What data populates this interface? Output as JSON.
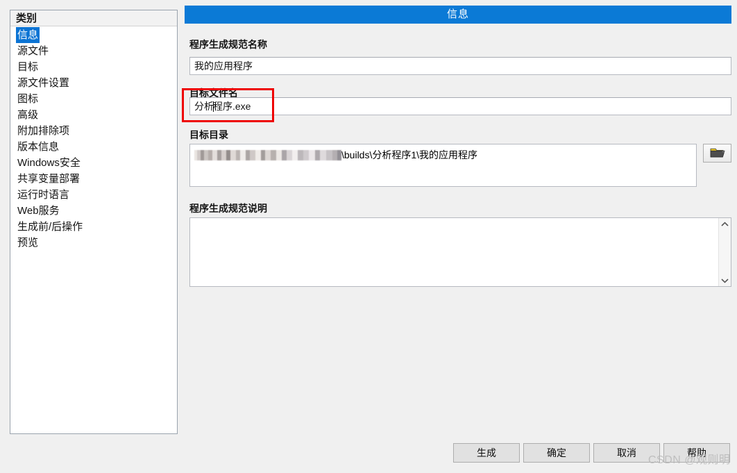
{
  "sidebar": {
    "header": "类别",
    "items": [
      {
        "label": "信息",
        "selected": true
      },
      {
        "label": "源文件",
        "selected": false
      },
      {
        "label": "目标",
        "selected": false
      },
      {
        "label": "源文件设置",
        "selected": false
      },
      {
        "label": "图标",
        "selected": false
      },
      {
        "label": "高级",
        "selected": false
      },
      {
        "label": "附加排除项",
        "selected": false
      },
      {
        "label": "版本信息",
        "selected": false
      },
      {
        "label": "Windows安全",
        "selected": false
      },
      {
        "label": "共享变量部署",
        "selected": false
      },
      {
        "label": "运行时语言",
        "selected": false
      },
      {
        "label": "Web服务",
        "selected": false
      },
      {
        "label": "生成前/后操作",
        "selected": false
      },
      {
        "label": "预览",
        "selected": false
      }
    ]
  },
  "panel": {
    "title": "信息",
    "title_bg": "#0b7ad6",
    "fields": {
      "spec_name": {
        "label": "程序生成规范名称",
        "value": "我的应用程序"
      },
      "target_file": {
        "label": "目标文件名",
        "value_before_caret": "分析",
        "value_after_caret": "程序.exe",
        "full_value": "分析程序.exe"
      },
      "target_dir": {
        "label": "目标目录",
        "redacted_prefix": true,
        "visible_value": "\\builds\\分析程序1\\我的应用程序",
        "browse_icon": "open-folder-icon"
      },
      "description": {
        "label": "程序生成规范说明",
        "value": "",
        "scroll_up_icon": "chevron-up-icon",
        "scroll_down_icon": "chevron-down-icon"
      }
    }
  },
  "annotation": {
    "color": "#ee0000",
    "targets": "目标文件名"
  },
  "buttons": {
    "generate": "生成",
    "ok": "确定",
    "cancel": "取消",
    "help": "帮助"
  },
  "watermark": {
    "text": "CSDN @观则明"
  }
}
